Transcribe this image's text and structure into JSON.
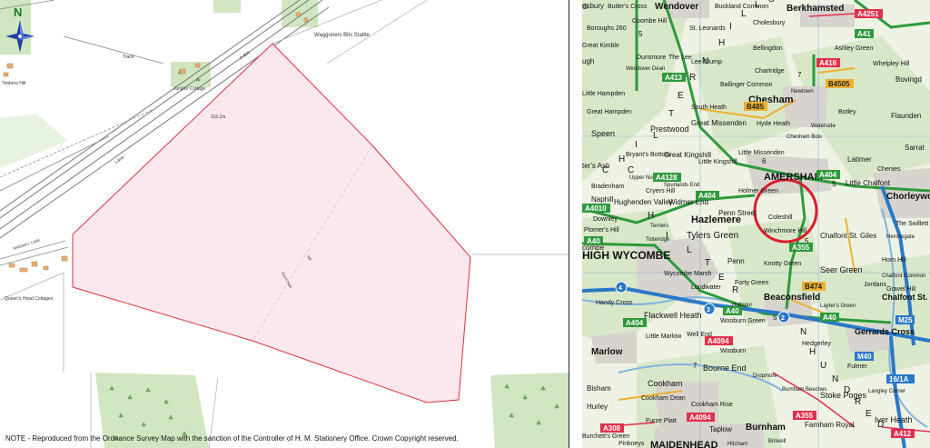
{
  "left_map": {
    "north_label": "N",
    "labels": {
      "waggoners": "Waggoners Bits Stable",
      "track": "Track",
      "road_a404": "A 404",
      "juniper": "Juniper Cottage",
      "timbers": "Timbers Hill",
      "lane": "Lane",
      "windmill": "WINDMILL LANE",
      "queens_head": "Queen's Head Cottages",
      "spot": "115.1m",
      "footpath": "Spurs Path",
      "hill": "Hill"
    },
    "footer_note": "NOTE  -  Reproduced from the Ordnance Survey Map with the sanction of the Controller of H. M. Stationery Office. Crown Copyright reserved.",
    "colors": {
      "site_fill": "#fbe7ee",
      "site_outline": "#d9343f",
      "trees": "#cfe6c0"
    }
  },
  "right_map": {
    "places": [
      {
        "key": "esbury",
        "text": "esbury"
      },
      {
        "key": "butlers",
        "text": "Butler's Cross"
      },
      {
        "key": "wendover",
        "text": "Wendover"
      },
      {
        "key": "buckland",
        "text": "Buckland Common"
      },
      {
        "key": "berkhamsted",
        "text": "Berkhamsted"
      },
      {
        "key": "coombe_hill",
        "text": "Coombe Hill"
      },
      {
        "key": "boroughs",
        "text": "Boroughs 260"
      },
      {
        "key": "st_leonards",
        "text": "St. Leonards"
      },
      {
        "key": "cholesbury",
        "text": "Cholesbury"
      },
      {
        "key": "bellingdon",
        "text": "Bellingdon"
      },
      {
        "key": "ashley_green",
        "text": "Ashley Green"
      },
      {
        "key": "great_kimble",
        "text": "Great Kimble"
      },
      {
        "key": "dunsmore",
        "text": "Dunsmore"
      },
      {
        "key": "the_lee",
        "text": "The Lee"
      },
      {
        "key": "wendover_dean",
        "text": "Wendover Dean"
      },
      {
        "key": "lee_clump",
        "text": "Lee Clump"
      },
      {
        "key": "chartridge",
        "text": "Chartridge"
      },
      {
        "key": "whelpley",
        "text": "Whelpley Hill"
      },
      {
        "key": "little_hampden",
        "text": "Little Hampden"
      },
      {
        "key": "ballinger",
        "text": "Ballinger Common"
      },
      {
        "key": "newtown",
        "text": "Newtown"
      },
      {
        "key": "bovingdon",
        "text": "Bovingd"
      },
      {
        "key": "chesham",
        "text": "Chesham"
      },
      {
        "key": "botley",
        "text": "Botley"
      },
      {
        "key": "great_hampden",
        "text": "Great Hampden"
      },
      {
        "key": "south_heath",
        "text": "South Heath"
      },
      {
        "key": "great_missenden",
        "text": "Great Missenden"
      },
      {
        "key": "hyde_heath",
        "text": "Hyde Heath"
      },
      {
        "key": "waterside",
        "text": "Waterside"
      },
      {
        "key": "flaunden",
        "text": "Flaunden"
      },
      {
        "key": "speen",
        "text": "Speen"
      },
      {
        "key": "prestwood",
        "text": "Prestwood"
      },
      {
        "key": "chesham_bois",
        "text": "Chesham Bois"
      },
      {
        "key": "little_missenden",
        "text": "Little Missenden"
      },
      {
        "key": "latimer",
        "text": "Latimer"
      },
      {
        "key": "sarratt",
        "text": "Sarrat"
      },
      {
        "key": "bryants",
        "text": "Bryant's Bottom"
      },
      {
        "key": "great_kingshill",
        "text": "Great Kingshill"
      },
      {
        "key": "little_kingshill",
        "text": "Little Kingshill"
      },
      {
        "key": "amersham",
        "text": "AMERSHAM"
      },
      {
        "key": "chenies",
        "text": "Chenies"
      },
      {
        "key": "ters_ash",
        "text": "ter's Ash"
      },
      {
        "key": "upper_north_dean",
        "text": "Upper North Dean"
      },
      {
        "key": "spurlands",
        "text": "Spurlands End"
      },
      {
        "key": "holmer_green",
        "text": "Holmer Green"
      },
      {
        "key": "little_chalfont",
        "text": "Little Chalfont"
      },
      {
        "key": "chorleywood",
        "text": "Chorleywood"
      },
      {
        "key": "bradenham",
        "text": "Bradenham"
      },
      {
        "key": "cryers_hill",
        "text": "Cryers Hill"
      },
      {
        "key": "hughenden",
        "text": "Hughenden Valley"
      },
      {
        "key": "widmer",
        "text": "Widmer End"
      },
      {
        "key": "penn_street",
        "text": "Penn Street"
      },
      {
        "key": "coleshill",
        "text": "Coleshill"
      },
      {
        "key": "naphill",
        "text": "Naphill"
      },
      {
        "key": "downley",
        "text": "Downley"
      },
      {
        "key": "plomers",
        "text": "Plomer's Hill"
      },
      {
        "key": "terriers",
        "text": "Terriers"
      },
      {
        "key": "hazlemere",
        "text": "Hazlemere"
      },
      {
        "key": "winchmore",
        "text": "Winchmore Hill"
      },
      {
        "key": "the_swillett",
        "text": "The Swillett"
      },
      {
        "key": "totteridge",
        "text": "Totteridge"
      },
      {
        "key": "tylers_green",
        "text": "Tylers Green"
      },
      {
        "key": "chalfont_st_giles",
        "text": "Chalfont St. Giles"
      },
      {
        "key": "heronsgate",
        "text": "Heronsgate"
      },
      {
        "key": "high_wycombe",
        "text": "HIGH WYCOMBE"
      },
      {
        "key": "combe",
        "text": "combe"
      },
      {
        "key": "penn",
        "text": "Penn"
      },
      {
        "key": "knotty",
        "text": "Knotty Green"
      },
      {
        "key": "seer_green",
        "text": "Seer Green"
      },
      {
        "key": "horn_hill",
        "text": "Horn Hill"
      },
      {
        "key": "wycombe_marsh",
        "text": "Wycombe Marsh"
      },
      {
        "key": "forty_green",
        "text": "Forty Green"
      },
      {
        "key": "jordans",
        "text": "Jordans"
      },
      {
        "key": "chalfont_common",
        "text": "Chalfont Common"
      },
      {
        "key": "gravel_hill",
        "text": "Gravel Hill"
      },
      {
        "key": "handy_cross",
        "text": "Handy Cross"
      },
      {
        "key": "loudwater",
        "text": "Loudwater"
      },
      {
        "key": "holtspur",
        "text": "Holtspur"
      },
      {
        "key": "beaconsfield",
        "text": "Beaconsfield"
      },
      {
        "key": "chalfont_st_peter",
        "text": "Chalfont St. Peter"
      },
      {
        "key": "flackwell",
        "text": "Flackwell Heath"
      },
      {
        "key": "wooburn_green",
        "text": "Wooburn Green"
      },
      {
        "key": "layters_green",
        "text": "Layter's Green"
      },
      {
        "key": "gerrards_cross",
        "text": "Gerrards Cross"
      },
      {
        "key": "little_marlow",
        "text": "Little Marlow"
      },
      {
        "key": "well_end",
        "text": "Well End"
      },
      {
        "key": "wooburn",
        "text": "Wooburn"
      },
      {
        "key": "marlow",
        "text": "Marlow"
      },
      {
        "key": "hedgerley",
        "text": "Hedgerley"
      },
      {
        "key": "bourne_end",
        "text": "Bourne End"
      },
      {
        "key": "dropmore",
        "text": "Dropmore"
      },
      {
        "key": "fulmer",
        "text": "Fulmer"
      },
      {
        "key": "bisham",
        "text": "Bisham"
      },
      {
        "key": "cookham",
        "text": "Cookham"
      },
      {
        "key": "cookham_dean",
        "text": "Cookham Dean"
      },
      {
        "key": "burnham_beeches",
        "text": "Burnham Beeches"
      },
      {
        "key": "stoke_poges",
        "text": "Stoke Poges"
      },
      {
        "key": "langley",
        "text": "Langley Corner"
      },
      {
        "key": "hurley",
        "text": "Hurley"
      },
      {
        "key": "cookham_rise",
        "text": "Cookham Rise"
      },
      {
        "key": "iver_heath",
        "text": "Iver Heath"
      },
      {
        "key": "furze_platt",
        "text": "Furze Platt"
      },
      {
        "key": "taplow",
        "text": "Taplow"
      },
      {
        "key": "burnham",
        "text": "Burnham"
      },
      {
        "key": "farnham_royal",
        "text": "Farnham Royal"
      },
      {
        "key": "burchetts",
        "text": "Burchett's Green"
      },
      {
        "key": "pinkneys",
        "text": "Pinkneys"
      },
      {
        "key": "maidenhead",
        "text": "MAIDENHEAD"
      },
      {
        "key": "hitcham",
        "text": "Hitcham"
      },
      {
        "key": "britwell",
        "text": "Britwell"
      },
      {
        "key": "great_kimble2",
        "text": "G"
      },
      {
        "key": "whiteleaf",
        "text": "ugh"
      }
    ],
    "roads": [
      {
        "key": "a4251",
        "text": "A4251"
      },
      {
        "key": "a41",
        "text": "A41"
      },
      {
        "key": "a416",
        "text": "A416"
      },
      {
        "key": "a413",
        "text": "A413"
      },
      {
        "key": "a404a",
        "text": "A404"
      },
      {
        "key": "a4128",
        "text": "A4128"
      },
      {
        "key": "a404b",
        "text": "A404"
      },
      {
        "key": "a4010",
        "text": "A4010"
      },
      {
        "key": "a40a",
        "text": "A40"
      },
      {
        "key": "a355",
        "text": "A355"
      },
      {
        "key": "a40b",
        "text": "A40"
      },
      {
        "key": "a40c",
        "text": "A40"
      },
      {
        "key": "m25",
        "text": "M25"
      },
      {
        "key": "a404c",
        "text": "A404"
      },
      {
        "key": "a4094",
        "text": "A4094"
      },
      {
        "key": "m40",
        "text": "M40"
      },
      {
        "key": "j16",
        "text": "16/1A"
      },
      {
        "key": "a355b",
        "text": "A355"
      },
      {
        "key": "a4094b",
        "text": "A4094"
      },
      {
        "key": "a308",
        "text": "A308"
      },
      {
        "key": "a412",
        "text": "A412"
      },
      {
        "key": "b485",
        "text": "B485"
      },
      {
        "key": "b4505",
        "text": "B4505"
      },
      {
        "key": "b474",
        "text": "B474"
      }
    ],
    "junctions": [
      {
        "key": "j4",
        "text": "4"
      },
      {
        "key": "j3",
        "text": "3"
      },
      {
        "key": "j2",
        "text": "2"
      }
    ],
    "grid_numbers": {
      "n5a": "5",
      "n6": "6",
      "n7": "7",
      "n5b": "5",
      "n7b": "7",
      "n5c": "5",
      "n8": "8"
    },
    "hills_letters": [
      "C",
      "H",
      "I",
      "L",
      "T",
      "E",
      "R",
      "N",
      "H",
      "I",
      "L",
      "L",
      "S",
      "C",
      "H",
      "I",
      "L",
      "T",
      "E",
      "R",
      "N",
      "H",
      "U",
      "N",
      "D",
      "R",
      "E",
      "D"
    ],
    "colors": {
      "primary_road": "#2e9a3c",
      "motorway": "#2a78c8",
      "a_road": "#e2304c",
      "b_road": "#f0b030",
      "water": "#7fb3e0",
      "urban": "#d7d3ce",
      "circle": "#d81e2a"
    }
  }
}
